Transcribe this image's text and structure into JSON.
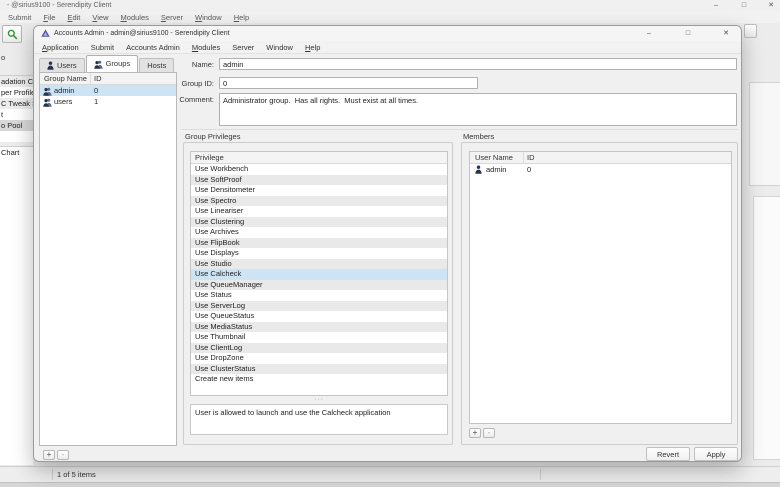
{
  "outer_window": {
    "title": "- @sirius9100 - Serendipity Client",
    "menu": [
      {
        "label": "Submit"
      },
      {
        "label": "File",
        "u": 0
      },
      {
        "label": "Edit",
        "u": 0
      },
      {
        "label": "View",
        "u": 0
      },
      {
        "label": "Modules",
        "u": 0
      },
      {
        "label": "Server",
        "u": 0
      },
      {
        "label": "Window",
        "u": 0
      },
      {
        "label": "Help",
        "u": 0
      }
    ],
    "status_text": "1 of 5 items"
  },
  "background_list": {
    "top_label": "o",
    "items": [
      "adation C",
      "per Profile",
      "C Tweak S",
      "t",
      "o Pool"
    ],
    "selected_item": "o Pool",
    "section2_item": "Chart"
  },
  "dialog": {
    "title": "Accounts Admin - admin@sirius9100 - Serendipity Client",
    "menu": [
      {
        "label": "Application",
        "u": 0
      },
      {
        "label": "Submit"
      },
      {
        "label": "Accounts Admin"
      },
      {
        "label": "Modules",
        "u": 0
      },
      {
        "label": "Server"
      },
      {
        "label": "Window"
      },
      {
        "label": "Help",
        "u": 0
      }
    ],
    "tabs": [
      {
        "label": "Users",
        "icon": "user"
      },
      {
        "label": "Groups",
        "icon": "users",
        "active": true
      },
      {
        "label": "Hosts"
      }
    ],
    "group_table": {
      "columns": [
        "Group Name",
        "ID"
      ],
      "rows": [
        {
          "name": "admin",
          "id": "0",
          "selected": true
        },
        {
          "name": "users",
          "id": "1",
          "selected": false
        }
      ]
    },
    "form": {
      "name_label": "Name:",
      "name_value": "admin",
      "group_id_label": "Group ID:",
      "group_id_value": "0",
      "comment_label": "Comment:",
      "comment_value": "Administrator group.  Has all rights.  Must exist at all times."
    },
    "privileges": {
      "section_title": "Group Privileges",
      "column_header": "Privilege",
      "selected": "Use Calcheck",
      "items": [
        "Use Workbench",
        "Use SoftProof",
        "Use Densitometer",
        "Use Spectro",
        "Use Lineariser",
        "Use Clustering",
        "Use Archives",
        "Use FlipBook",
        "Use Displays",
        "Use Studio",
        "Use Calcheck",
        "Use QueueManager",
        "Use Status",
        "Use ServerLog",
        "Use QueueStatus",
        "Use MediaStatus",
        "Use Thumbnail",
        "Use ClientLog",
        "Use DropZone",
        "Use ClusterStatus",
        "Create new items"
      ],
      "description": "User is allowed to launch and use the Calcheck application"
    },
    "members": {
      "section_title": "Members",
      "columns": [
        "User Name",
        "ID"
      ],
      "rows": [
        {
          "name": "admin",
          "id": "0"
        }
      ]
    },
    "buttons": {
      "revert": "Revert",
      "apply": "Apply",
      "add": "+",
      "remove": "-"
    }
  },
  "glyphs": {
    "minimize": "–",
    "maximize": "□",
    "close": "✕",
    "splitter": "···"
  },
  "colors": {
    "selection": "#cde4f5",
    "inactive_selection": "#d8d8d8",
    "logo_purple": "#5b4b9e",
    "search_green": "#2f8f2f"
  }
}
